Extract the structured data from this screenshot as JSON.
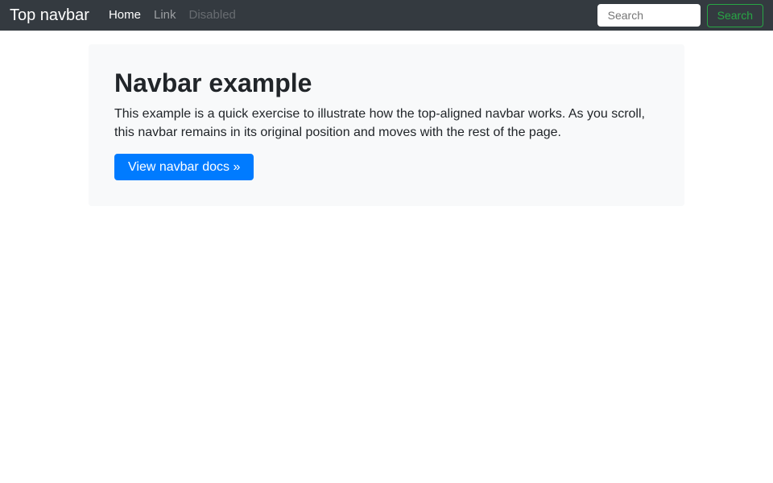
{
  "navbar": {
    "brand": "Top navbar",
    "links": [
      {
        "label": "Home",
        "state": "active"
      },
      {
        "label": "Link",
        "state": "muted"
      },
      {
        "label": "Disabled",
        "state": "disabled"
      }
    ],
    "search": {
      "placeholder": "Search",
      "value": "",
      "button_label": "Search"
    }
  },
  "jumbotron": {
    "title": "Navbar example",
    "description": "This example is a quick exercise to illustrate how the top-aligned navbar works. As you scroll, this navbar remains in its original position and moves with the rest of the page.",
    "cta_label": "View navbar docs »"
  },
  "colors": {
    "navbar_bg": "#343a40",
    "primary": "#007bff",
    "success": "#28a745",
    "jumbotron_bg": "#f8f9fa",
    "text": "#212529"
  }
}
